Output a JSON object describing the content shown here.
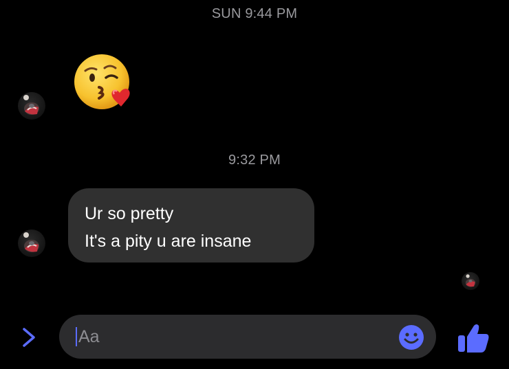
{
  "conversation": {
    "timestamp_1": "SUN 9:44 PM",
    "timestamp_2": "9:32 PM"
  },
  "messages": [
    {
      "type": "emoji",
      "emoji": "face-blowing-a-kiss",
      "sender": "other"
    },
    {
      "type": "text",
      "sender": "other",
      "lines": [
        "Ur so pretty",
        "It's a pity u are insane"
      ]
    }
  ],
  "composer": {
    "placeholder": "Aa",
    "value": ""
  },
  "icons": {
    "expand": "chevron-right-icon",
    "emoji_picker": "smiley-icon",
    "like": "thumbs-up-icon",
    "avatar": "contact-avatar",
    "read_receipt": "seen-avatar"
  },
  "colors": {
    "background": "#000000",
    "bubble": "#303030",
    "composer": "#2c2c2e",
    "accent": "#5b6cff",
    "timestamp": "#9a9a9e"
  }
}
